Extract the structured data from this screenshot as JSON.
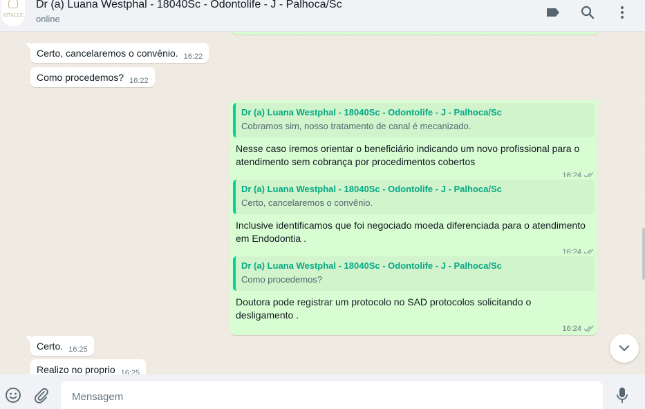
{
  "header": {
    "avatar_text": "VITALLE",
    "title": "Dr (a) Luana Westphal - 18040Sc - Odontolife - J - Palhoca/Sc",
    "status": "online",
    "icons": [
      "label-icon",
      "search-icon",
      "menu-icon"
    ]
  },
  "incoming": [
    {
      "text": "Certo, cancelaremos o convênio.",
      "time": "16:22"
    },
    {
      "text": "Como procedemos?",
      "time": "16:22"
    },
    {
      "text": "Certo.",
      "time": "16:25"
    },
    {
      "text": "Realizo no proprio",
      "time": "16:25"
    }
  ],
  "outgoing": [
    {
      "quote_author": "Dr (a) Luana Westphal - 18040Sc - Odontolife - J - Palhoca/Sc",
      "quote_text": "Cobramos sim, nosso tratamento de canal é mecanizado.",
      "line1": "Nesse caso iremos orientar o beneficiário indicando um novo profissional para o",
      "line2": "atendimento sem cobrança por procedimentos cobertos",
      "time": "16:24"
    },
    {
      "quote_author": "Dr (a) Luana Westphal - 18040Sc - Odontolife - J - Palhoca/Sc",
      "quote_text": "Certo, cancelaremos o convênio.",
      "line1": "Inclusive identificamos que foi negociado moeda diferenciada para o atendimento",
      "line2": "em Endodontia .",
      "time": "16:24"
    },
    {
      "quote_author": "Dr (a) Luana Westphal - 18040Sc - Odontolife - J - Palhoca/Sc",
      "quote_text": "Como procedemos?",
      "line1": "Doutora pode registrar um protocolo no SAD protocolos solicitando o",
      "line2": "desligamento .",
      "time": "16:24"
    }
  ],
  "footer": {
    "placeholder": "Mensagem",
    "icons": [
      "emoji-icon",
      "attach-icon",
      "microphone-icon"
    ]
  },
  "colors": {
    "outgoing_bubble": "#d9fdd3",
    "quote_bar": "#06cf9c",
    "quote_author": "#06a884",
    "read_ticks": "#8696a0"
  }
}
